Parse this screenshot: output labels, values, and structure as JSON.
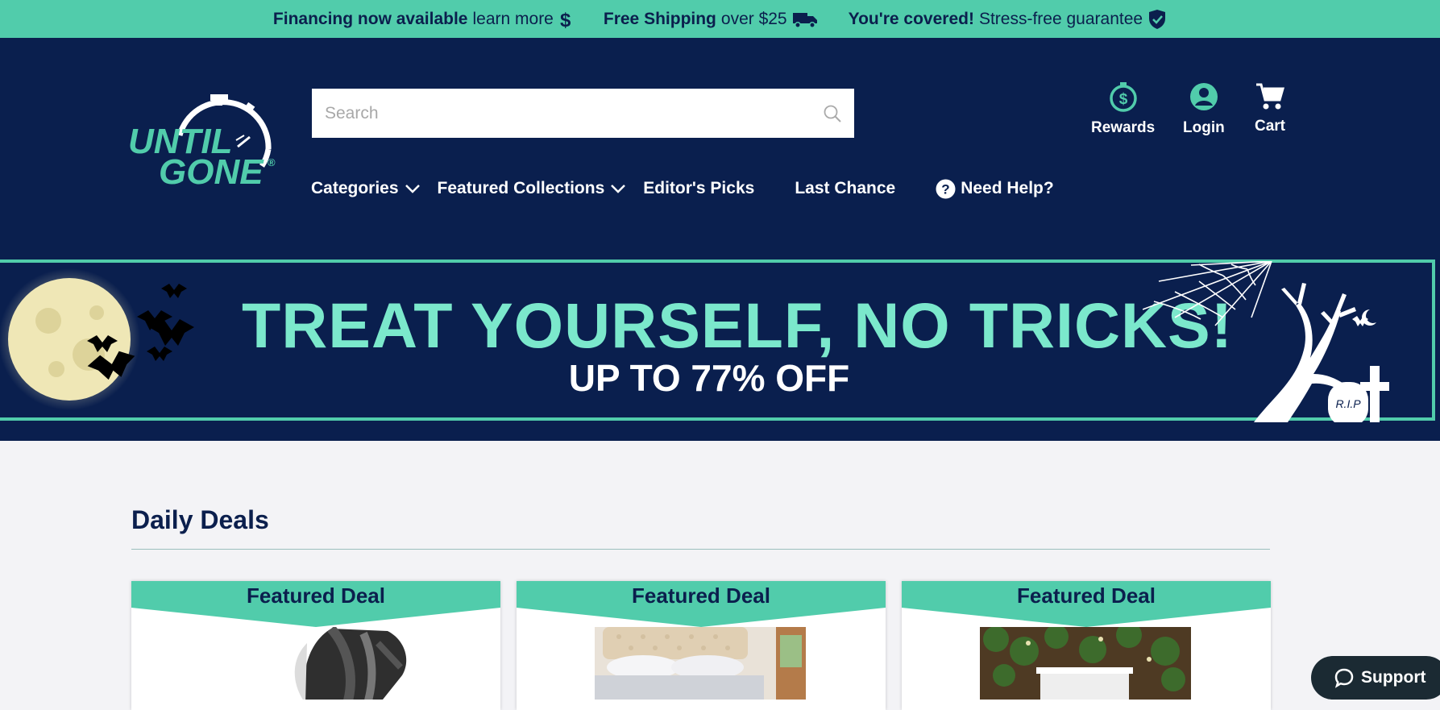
{
  "promo": {
    "financing_bold": "Financing now available",
    "financing_light": "learn more",
    "shipping_bold": "Free Shipping",
    "shipping_light": "over $25",
    "covered_bold": "You're covered!",
    "covered_light": "Stress-free guarantee"
  },
  "header": {
    "logo_top": "UNTIL",
    "logo_bottom": "GONE",
    "search_placeholder": "Search",
    "nav": {
      "categories": "Categories",
      "featured": "Featured Collections",
      "editors": "Editor's Picks",
      "last_chance": "Last Chance",
      "help": "Need Help?"
    },
    "util": {
      "rewards": "Rewards",
      "login": "Login",
      "cart": "Cart"
    }
  },
  "banner": {
    "headline": "TREAT YOURSELF, NO TRICKS!",
    "subline": "UP TO 77% OFF",
    "tombstone": "R.I.P"
  },
  "deals": {
    "title": "Daily Deals",
    "cards": [
      {
        "label": "Featured Deal"
      },
      {
        "label": "Featured Deal"
      },
      {
        "label": "Featured Deal"
      }
    ]
  },
  "support": {
    "label": "Support"
  },
  "colors": {
    "navy": "#0a1f4e",
    "teal": "#51ccab",
    "mint": "#7be8cc",
    "page_bg": "#f3f3f6"
  }
}
